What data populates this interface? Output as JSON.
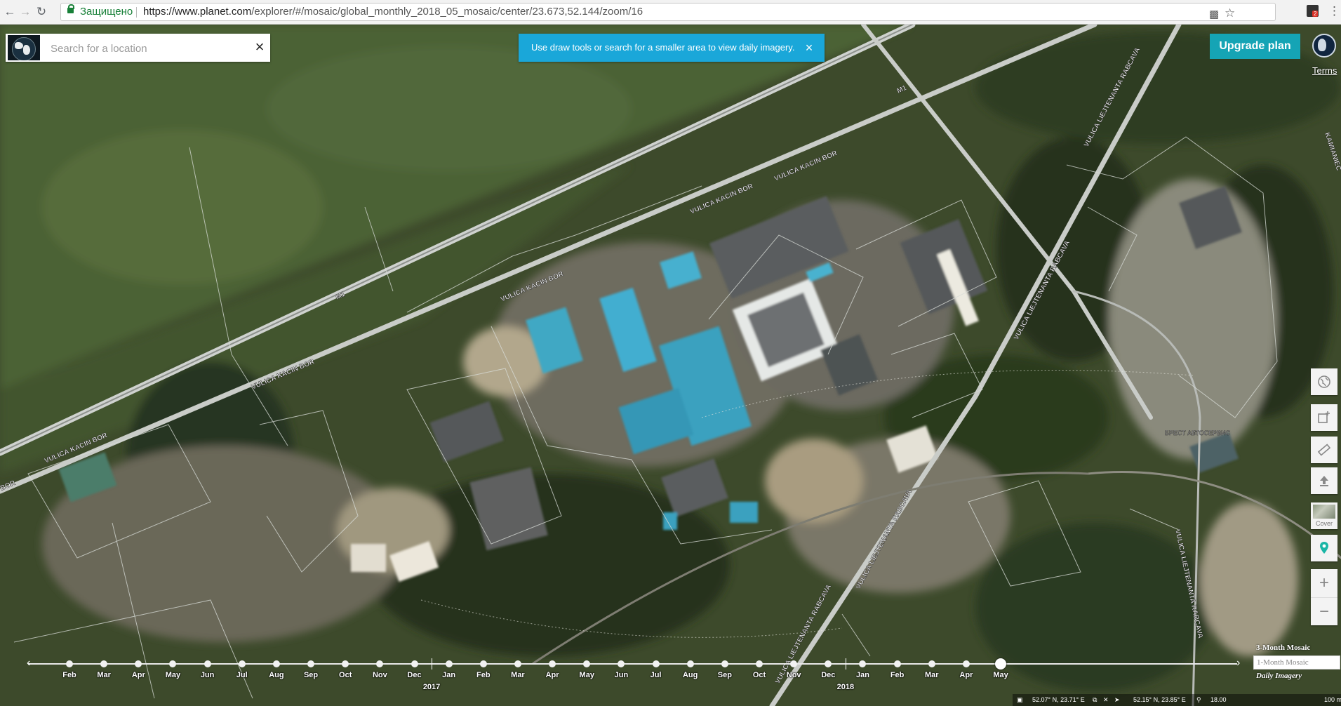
{
  "browser": {
    "secure_label": "Защищено",
    "url_host": "https://www.planet.com",
    "url_path": "/explorer/#/mosaic/global_monthly_2018_05_mosaic/center/23.673,52.144/zoom/16",
    "ext_badge": "2"
  },
  "search": {
    "placeholder": "Search for a location",
    "clear_label": "×"
  },
  "notice": {
    "text": "Use draw tools or search for a smaller area to view daily imagery.",
    "close_label": "×"
  },
  "account": {
    "upgrade_label": "Upgrade plan",
    "terms_label": "Terms"
  },
  "map_labels": {
    "road_m1_a": "M1",
    "road_m1_b": "M1",
    "kacin_bor_1": "VULICA KACIN BOR",
    "kacin_bor_2": "VULICA KACIN BOR",
    "kacin_bor_3": "VULICA KACIN BOR",
    "kacin_bor_4": "VULICA KACIN BOR",
    "kacin_bor_5": "VULICA KACIN BOR",
    "kacin_bor_6": "BOR",
    "rabcava_1": "VULICA LIEJTENANTA RABCAVA",
    "rabcava_2": "VULICA LIEJTENANTA RABCAVA",
    "rabcava_3": "VULICA LIEJTENANTA RABCAVA",
    "rabcava_4": "VULICA LIEJTENANTA RABCAVA",
    "rabcava_5": "VULICA LIEJTENANTA RABCAVA",
    "kamian": "KAMIANIEC",
    "poi": "БРЕСТ АВТОСЕРВИС"
  },
  "tools": {
    "cover_label": "Cover",
    "zoom_in_label": "+",
    "zoom_out_label": "−"
  },
  "timeline": {
    "months": [
      "Feb",
      "Mar",
      "Apr",
      "May",
      "Jun",
      "Jul",
      "Aug",
      "Sep",
      "Oct",
      "Nov",
      "Dec",
      "Jan",
      "Feb",
      "Mar",
      "Apr",
      "May",
      "Jun",
      "Jul",
      "Aug",
      "Sep",
      "Oct",
      "Nov",
      "Dec",
      "Jan",
      "Feb",
      "Mar",
      "Apr",
      "May"
    ],
    "years": [
      "2017",
      "2018"
    ],
    "selected_month": "May"
  },
  "mosaic_modes": [
    "3-Month Mosaic",
    "1-Month Mosaic",
    "Daily Imagery"
  ],
  "active_mode": "1-Month Mosaic",
  "status": {
    "coords_a": "52.07° N, 23.71° E",
    "coords_b": "52.15° N, 23.85° E",
    "zoom": "18.00",
    "scale": "100 m"
  },
  "colors": {
    "notice": "#1aa7d9",
    "upgrade": "#15a4b5",
    "roof_blue": "#3fa8c4"
  }
}
